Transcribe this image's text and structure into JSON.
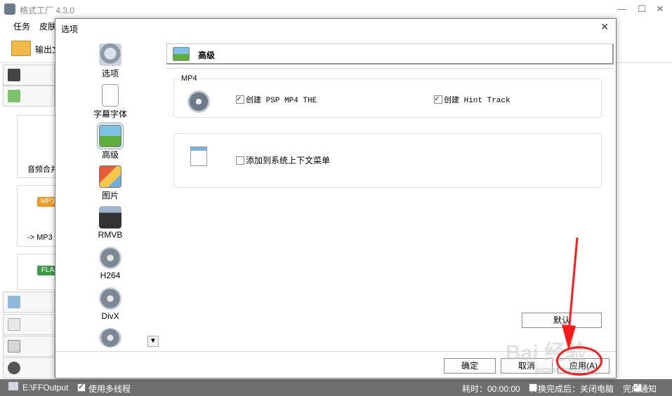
{
  "app": {
    "title": "格式工厂 4.3.0",
    "menu": [
      "任务",
      "皮肤"
    ],
    "toolbar_output_label": "输出文",
    "window_controls": [
      "—",
      "☐",
      "✕"
    ]
  },
  "left_panel": {
    "cards": [
      {
        "label": "音频合并"
      },
      {
        "badge": "MP3",
        "label": "-> MP3"
      },
      {
        "badge": "FLA",
        "label": ""
      }
    ]
  },
  "status_bar": {
    "output_path": "E:\\FFOutput",
    "multithread_label": "使用多线程",
    "elapsed_label": "耗时：00:00:00",
    "after_convert_label": "转换完成后：关闭电脑",
    "notify_label": "完成通知"
  },
  "dialog": {
    "title": "选项",
    "close_glyph": "✕",
    "nav": [
      {
        "label": "选项",
        "icon": "camera-reel-icon"
      },
      {
        "label": "字幕字体",
        "icon": "font-document-icon"
      },
      {
        "label": "高级",
        "icon": "landscape-icon",
        "active": true
      },
      {
        "label": "图片",
        "icon": "picture-icon"
      },
      {
        "label": "RMVB",
        "icon": "real-media-icon"
      },
      {
        "label": "H264",
        "icon": "film-reel-icon"
      },
      {
        "label": "DivX",
        "icon": "film-reel-icon"
      },
      {
        "label": "",
        "icon": "film-reel-icon"
      }
    ],
    "section_title": "高级",
    "mp4_group": {
      "legend": "MP4",
      "option1": "创建 PSP MP4 THE",
      "option1_checked": true,
      "option2": "创建 Hint Track",
      "option2_checked": true
    },
    "context_group": {
      "option": "添加到系统上下文菜单",
      "checked": false
    },
    "buttons": {
      "default": "默认",
      "ok": "确定",
      "cancel": "取消",
      "apply": "应用(A)"
    }
  },
  "watermark": {
    "text": "Bai 经验",
    "url": "jingyan.baidu.com"
  }
}
